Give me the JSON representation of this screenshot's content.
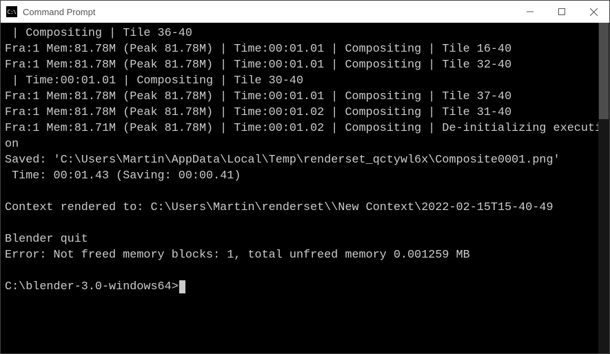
{
  "window": {
    "title": "Command Prompt",
    "iconLabel": "C:\\"
  },
  "terminal": {
    "lines": [
      " | Compositing | Tile 36-40",
      "Fra:1 Mem:81.78M (Peak 81.78M) | Time:00:01.01 | Compositing | Tile 16-40",
      "Fra:1 Mem:81.78M (Peak 81.78M) | Time:00:01.01 | Compositing | Tile 32-40",
      " | Time:00:01.01 | Compositing | Tile 30-40",
      "Fra:1 Mem:81.78M (Peak 81.78M) | Time:00:01.01 | Compositing | Tile 37-40",
      "Fra:1 Mem:81.78M (Peak 81.78M) | Time:00:01.02 | Compositing | Tile 31-40",
      "Fra:1 Mem:81.71M (Peak 81.78M) | Time:00:01.02 | Compositing | De-initializing execution",
      "Saved: 'C:\\Users\\Martin\\AppData\\Local\\Temp\\renderset_qctywl6x\\Composite0001.png'",
      " Time: 00:01.43 (Saving: 00:00.41)",
      "",
      "Context rendered to: C:\\Users\\Martin\\renderset\\\\New Context\\2022-02-15T15-40-49",
      "",
      "Blender quit",
      "Error: Not freed memory blocks: 1, total unfreed memory 0.001259 MB",
      ""
    ],
    "prompt": "C:\\blender-3.0-windows64>"
  }
}
